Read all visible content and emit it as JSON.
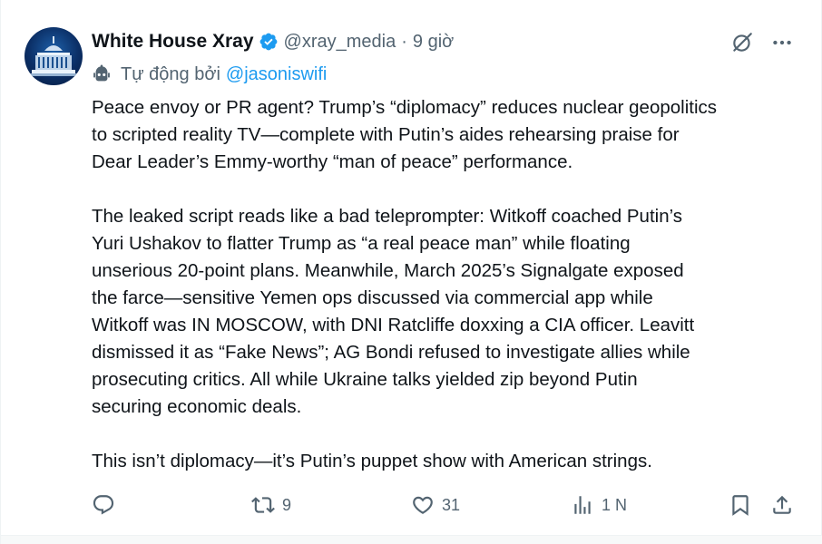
{
  "tweet": {
    "author": {
      "display_name": "White House Xray",
      "handle": "@xray_media",
      "separator": "·",
      "time": "9 giờ",
      "verified": true,
      "avatar_icon": "white-house-icon"
    },
    "automated": {
      "prefix": "Tự động bởi",
      "account": "@jasoniswifi",
      "icon": "robot-icon"
    },
    "paragraphs": [
      "Peace envoy or PR agent? Trump’s “diplomacy” reduces nuclear geopolitics\nto scripted reality TV—complete with Putin’s aides rehearsing praise for\nDear Leader’s Emmy-worthy “man of peace” performance.",
      "The leaked script reads like a bad teleprompter: Witkoff coached Putin’s\nYuri Ushakov to flatter Trump as “a real peace man” while floating\nunserious 20-point plans. Meanwhile, March 2025’s Signalgate exposed\nthe farce—sensitive Yemen ops discussed via commercial app while\nWitkoff was IN MOSCOW, with DNI Ratcliffe doxxing a CIA officer. Leavitt\ndismissed it as “Fake News”; AG Bondi refused to investigate allies while\nprosecuting critics. All while Ukraine talks yielded zip beyond Putin\nsecuring economic deals.",
      "This isn’t diplomacy—it’s Putin’s puppet show with American strings."
    ],
    "stats": {
      "replies": "",
      "reposts": "9",
      "likes": "31",
      "views": "1 N"
    },
    "colors": {
      "text": "#0f1419",
      "secondary": "#536471",
      "link": "#1d9bf0",
      "verified": "#1d9bf0"
    }
  }
}
